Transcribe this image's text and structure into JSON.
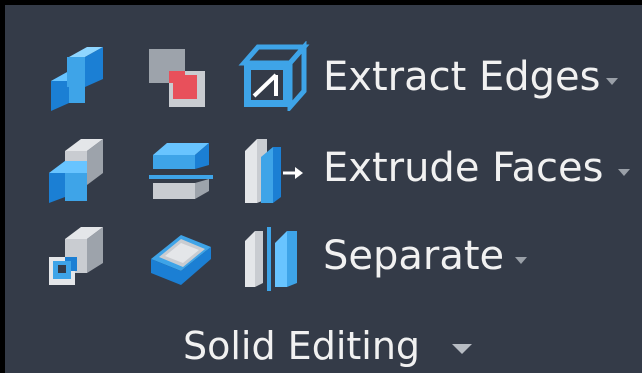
{
  "panel": {
    "title": "Solid Editing"
  },
  "row1": {
    "extract_edges": {
      "label": "Extract Edges",
      "icon": "extract-edges-icon"
    },
    "tools": [
      "union-icon",
      "subtract-icon"
    ]
  },
  "row2": {
    "extrude_faces": {
      "label": "Extrude Faces",
      "icon": "extrude-faces-icon"
    },
    "tools": [
      "intersect-icon",
      "slice-icon"
    ]
  },
  "row3": {
    "separate": {
      "label": "Separate",
      "icon": "separate-icon"
    },
    "tools": [
      "interfere-icon",
      "shell-icon"
    ]
  },
  "colors": {
    "background": "#343b48",
    "text": "#f1f1f1",
    "accent_blue": "#3ea4e8",
    "accent_red": "#e8505b"
  }
}
